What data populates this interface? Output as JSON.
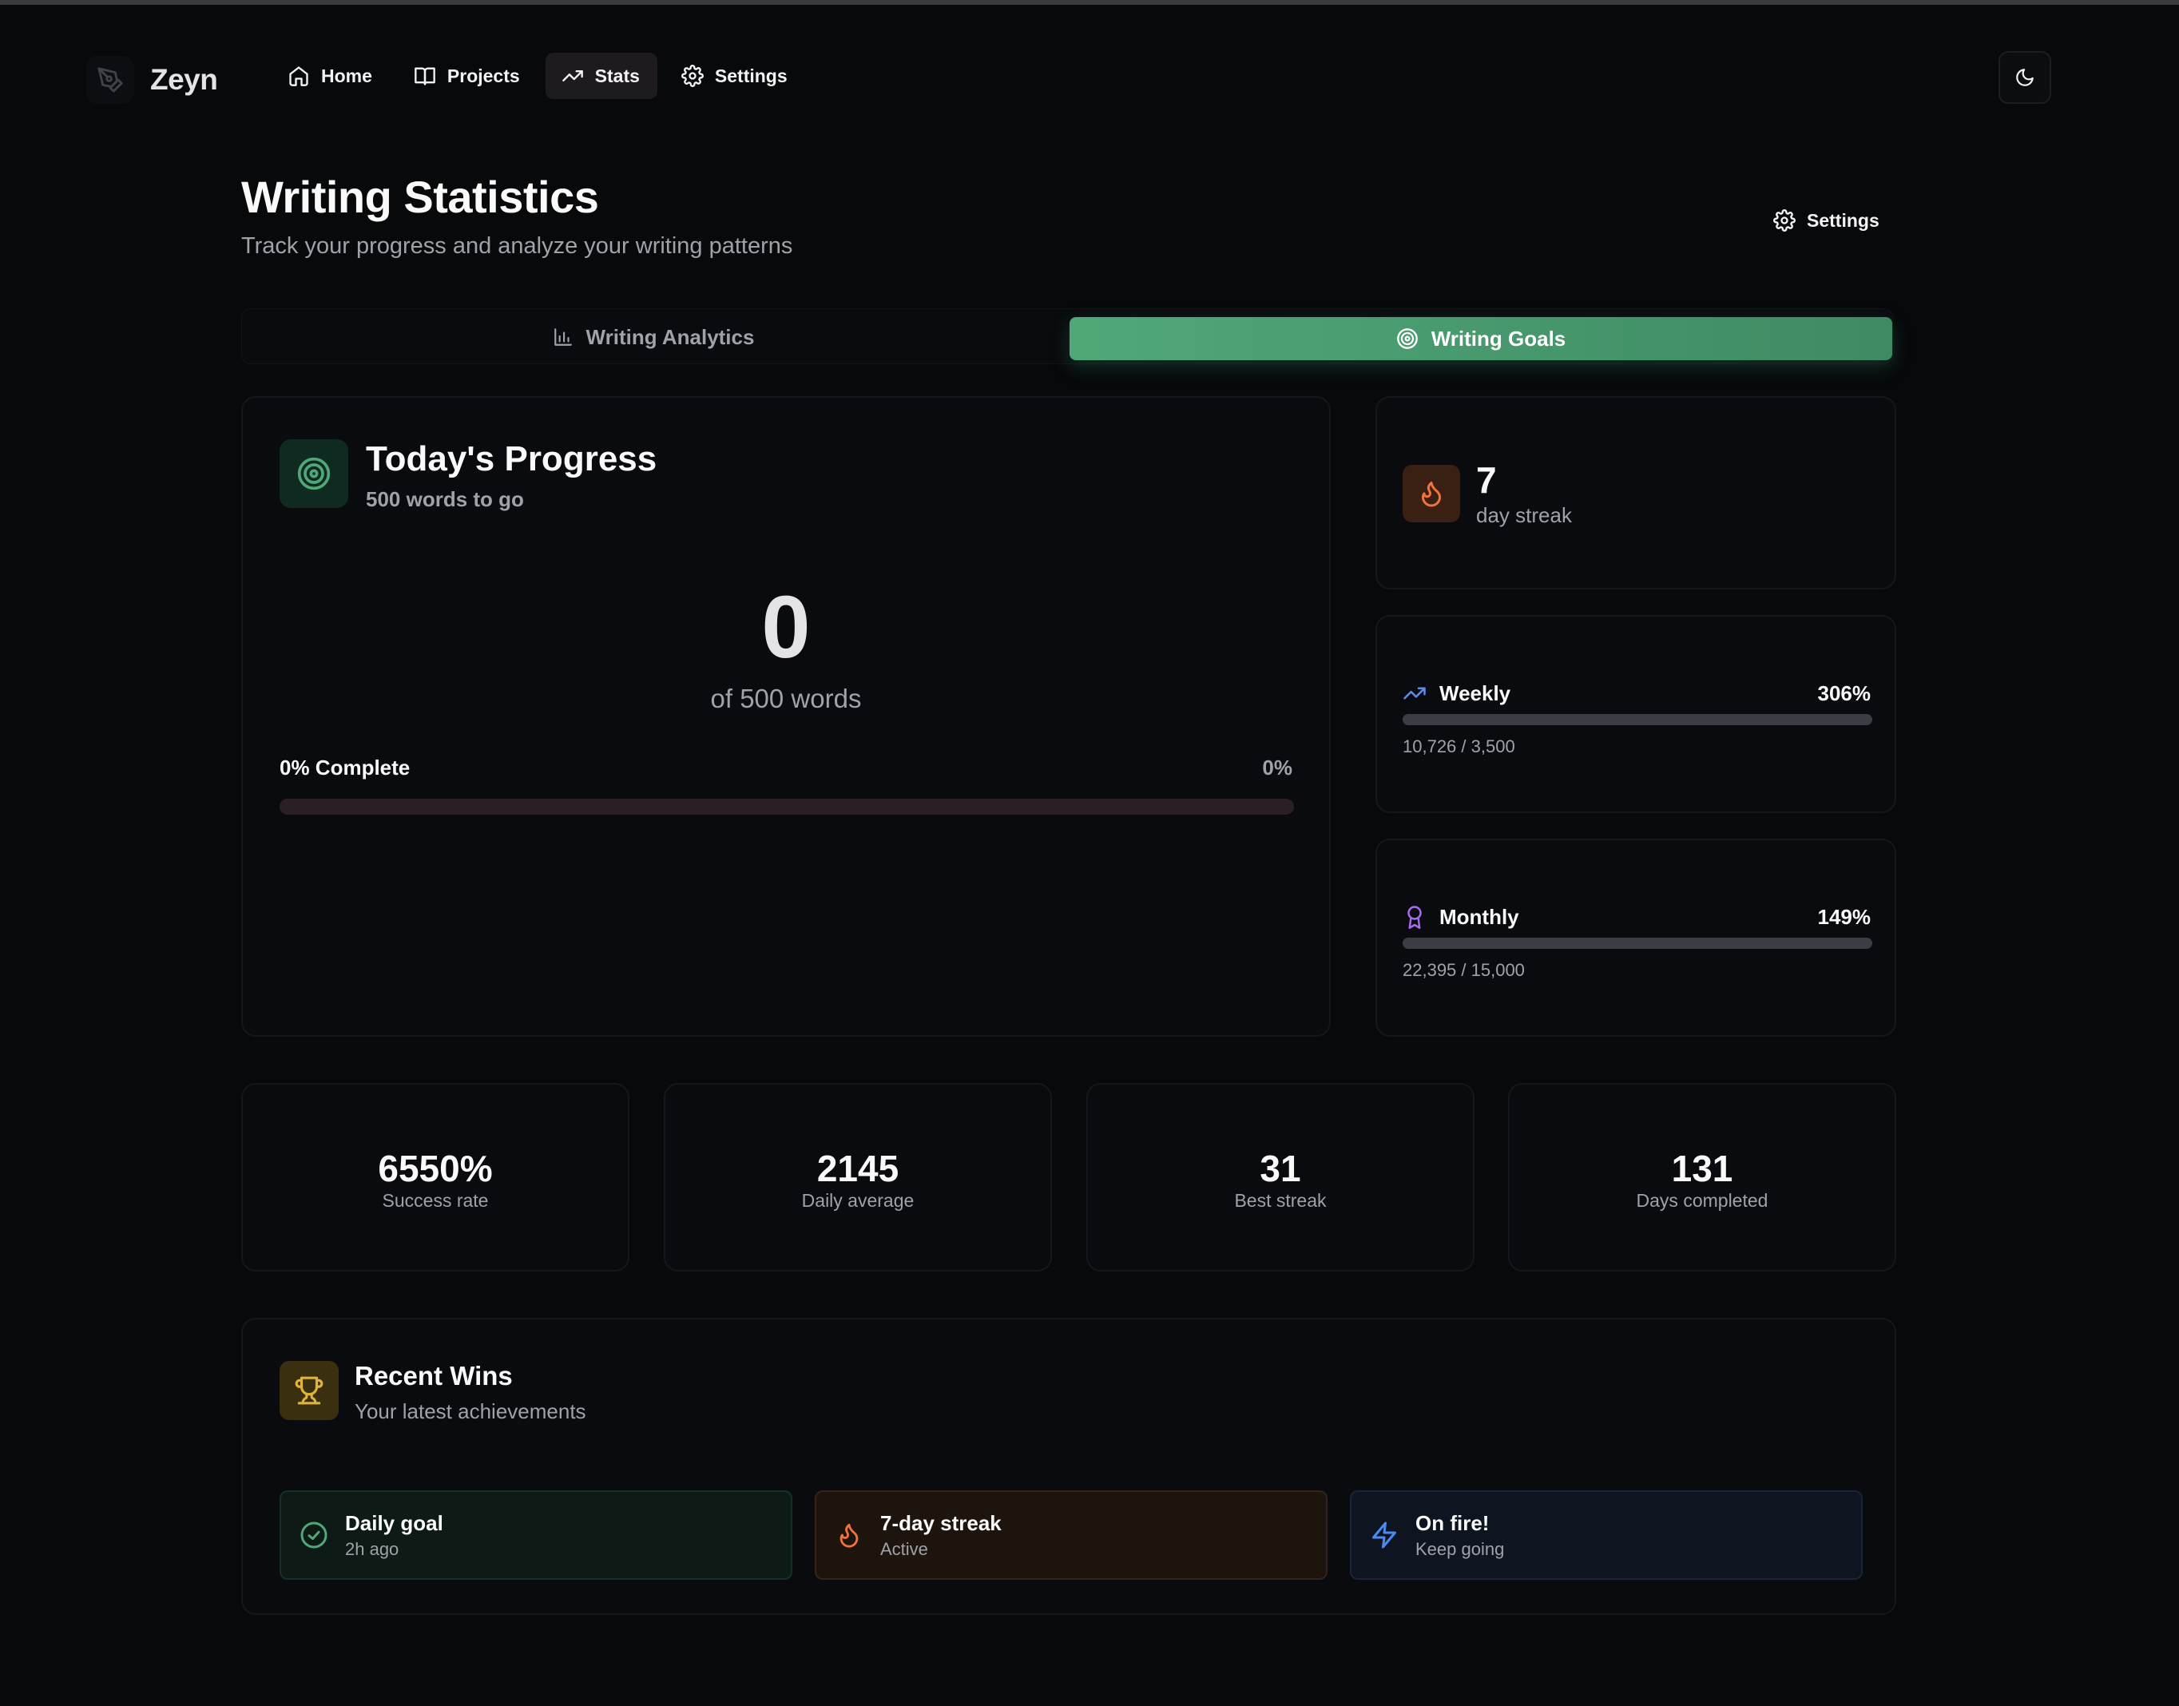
{
  "app": {
    "name": "Zeyn"
  },
  "nav": {
    "items": [
      {
        "label": "Home",
        "icon": "home-icon"
      },
      {
        "label": "Projects",
        "icon": "book-icon"
      },
      {
        "label": "Stats",
        "icon": "trending-up-icon",
        "active": true
      },
      {
        "label": "Settings",
        "icon": "gear-icon"
      }
    ],
    "theme_toggle_icon": "moon-icon"
  },
  "header": {
    "title": "Writing Statistics",
    "subtitle": "Track your progress and analyze your writing patterns",
    "settings_label": "Settings"
  },
  "tabs": [
    {
      "label": "Writing Analytics",
      "icon": "bar-chart-icon",
      "active": false
    },
    {
      "label": "Writing Goals",
      "icon": "target-icon",
      "active": true
    }
  ],
  "today": {
    "title": "Today's Progress",
    "subtitle": "500 words to go",
    "words": "0",
    "of_label": "of 500 words",
    "complete_label": "0% Complete",
    "percent_label": "0%",
    "progress_fraction": 0
  },
  "streak": {
    "value": "7",
    "label": "day streak"
  },
  "weekly": {
    "name": "Weekly",
    "percent": "306%",
    "value": "10,726 / 3,500",
    "progress_fraction": 1.0
  },
  "monthly": {
    "name": "Monthly",
    "percent": "149%",
    "value": "22,395 / 15,000",
    "progress_fraction": 1.0
  },
  "stats": [
    {
      "value": "6550%",
      "label": "Success rate"
    },
    {
      "value": "2145",
      "label": "Daily average"
    },
    {
      "value": "31",
      "label": "Best streak"
    },
    {
      "value": "131",
      "label": "Days completed"
    }
  ],
  "wins": {
    "title": "Recent Wins",
    "subtitle": "Your latest achievements",
    "items": [
      {
        "title": "Daily goal",
        "sub": "2h ago",
        "icon": "check-circle-icon"
      },
      {
        "title": "7-day streak",
        "sub": "Active",
        "icon": "flame-icon"
      },
      {
        "title": "On fire!",
        "sub": "Keep going",
        "icon": "lightning-icon"
      }
    ]
  },
  "colors": {
    "accent": "#50a879",
    "flame": "#f0743a",
    "trophy": "#e0b43a",
    "weekly_icon": "#5b8def",
    "monthly_icon": "#a66cf0",
    "lightning": "#4a8af4"
  }
}
